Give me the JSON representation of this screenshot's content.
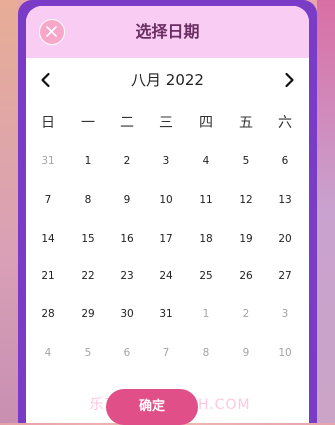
{
  "dialog": {
    "title": "选择日期",
    "month_label": "八月 2022",
    "confirm_label": "确定"
  },
  "icons": {
    "close": "close-icon",
    "prev": "chevron-left-icon",
    "next": "chevron-right-icon"
  },
  "weekdays": [
    "日",
    "一",
    "二",
    "三",
    "四",
    "五",
    "六"
  ],
  "calendar": {
    "weeks": [
      [
        "31",
        "1",
        "2",
        "3",
        "4",
        "5",
        "6"
      ],
      [
        "7",
        "8",
        "9",
        "10",
        "11",
        "12",
        "13"
      ],
      [
        "14",
        "15",
        "16",
        "17",
        "18",
        "19",
        "20"
      ],
      [
        "21",
        "22",
        "23",
        "24",
        "25",
        "26",
        "27"
      ],
      [
        "28",
        "29",
        "30",
        "31",
        "1",
        "2",
        "3"
      ],
      [
        "4",
        "5",
        "6",
        "7",
        "8",
        "9",
        "10"
      ]
    ],
    "muted": [
      [
        true,
        false,
        false,
        false,
        false,
        false,
        false
      ],
      [
        false,
        false,
        false,
        false,
        false,
        false,
        false
      ],
      [
        false,
        false,
        false,
        false,
        false,
        false,
        false
      ],
      [
        false,
        false,
        false,
        false,
        false,
        false,
        false
      ],
      [
        false,
        false,
        false,
        false,
        true,
        true,
        true
      ],
      [
        true,
        true,
        true,
        true,
        true,
        true,
        true
      ]
    ]
  },
  "watermark": "乐享轻汇·NYCQH.COM",
  "colors": {
    "frame": "#7a3bc7",
    "header": "#f9cdf3",
    "title": "#6a2d62",
    "confirm": "#e14f88",
    "close": "#f7a7c8"
  }
}
